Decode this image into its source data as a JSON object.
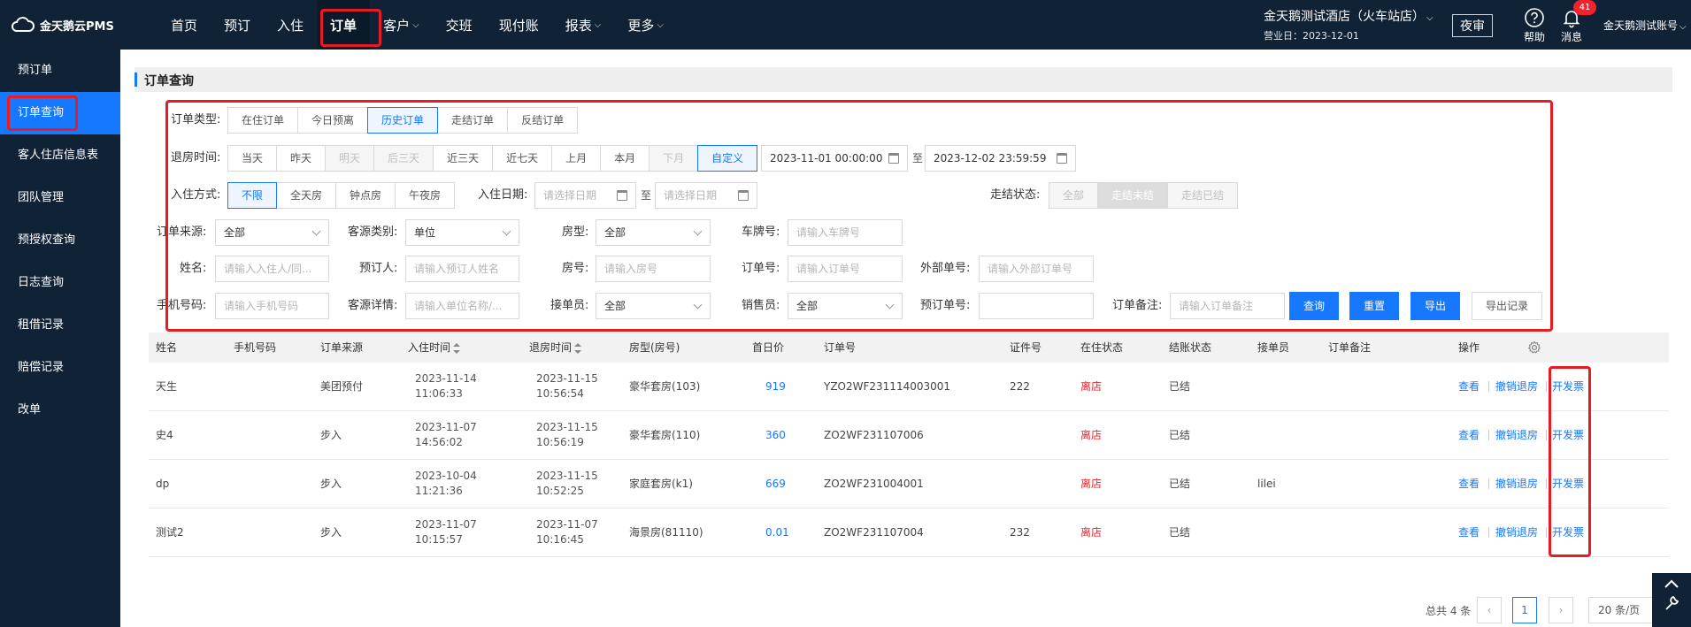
{
  "app": {
    "logo_text": "金天鹅云PMS"
  },
  "nav": [
    {
      "label": "首页",
      "chevron": false
    },
    {
      "label": "预订",
      "chevron": false
    },
    {
      "label": "入住",
      "chevron": false
    },
    {
      "label": "订单",
      "chevron": false,
      "active": true
    },
    {
      "label": "客户",
      "chevron": true
    },
    {
      "label": "交班",
      "chevron": false
    },
    {
      "label": "现付账",
      "chevron": false
    },
    {
      "label": "报表",
      "chevron": true
    },
    {
      "label": "更多",
      "chevron": true
    }
  ],
  "header": {
    "hotel_name": "金天鹅测试酒店（火车站店）",
    "business_date": "营业日：2023-12-01",
    "night_audit_label": "夜审",
    "help_label": "帮助",
    "messages_label": "消息",
    "message_count": "41",
    "user_name": "金天鹅测试账号"
  },
  "sidebar": [
    {
      "label": "预订单"
    },
    {
      "label": "订单查询",
      "active": true
    },
    {
      "label": "客人住店信息表"
    },
    {
      "label": "团队管理"
    },
    {
      "label": "预授权查询"
    },
    {
      "label": "日志查询"
    },
    {
      "label": "租借记录"
    },
    {
      "label": "赔偿记录"
    },
    {
      "label": "改单"
    }
  ],
  "page": {
    "title": "订单查询"
  },
  "filters": {
    "order_type": {
      "label": "订单类型:",
      "options": [
        "在住订单",
        "今日预离",
        "历史订单",
        "走结订单",
        "反结订单"
      ],
      "selected": "历史订单"
    },
    "checkout_time": {
      "label": "退房时间:",
      "options": [
        "当天",
        "昨天",
        "明天",
        "后三天",
        "近三天",
        "近七天",
        "上月",
        "本月",
        "下月",
        "自定义"
      ],
      "disabled": [
        "明天",
        "后三天",
        "下月"
      ],
      "selected": "自定义",
      "from": "2023-11-01 00:00:00",
      "to_label": "至",
      "to": "2023-12-02 23:59:59"
    },
    "checkin_method": {
      "label": "入住方式:",
      "options": [
        "不限",
        "全天房",
        "钟点房",
        "午夜房"
      ],
      "selected": "不限"
    },
    "checkin_date": {
      "label": "入住日期:",
      "placeholder_from": "请选择日期",
      "to_label": "至",
      "placeholder_to": "请选择日期"
    },
    "settle_status": {
      "label": "走结状态:",
      "options": [
        "全部",
        "走结未结",
        "走结已结"
      ]
    },
    "order_source": {
      "label": "订单来源:",
      "value": "全部"
    },
    "guest_category": {
      "label": "客源类别:",
      "value": "单位"
    },
    "room_type": {
      "label": "房型:",
      "value": "全部"
    },
    "plate": {
      "label": "车牌号:",
      "placeholder": "请输入车牌号"
    },
    "name": {
      "label": "姓名:",
      "placeholder": "请输入入住人/同..."
    },
    "booker": {
      "label": "预订人:",
      "placeholder": "请输入预订人姓名"
    },
    "room_no": {
      "label": "房号:",
      "placeholder": "请输入房号"
    },
    "order_no": {
      "label": "订单号:",
      "placeholder": "请输入订单号"
    },
    "external_no": {
      "label": "外部单号:",
      "placeholder": "请输入外部订单号"
    },
    "phone": {
      "label": "手机号码:",
      "placeholder": "请输入手机号码"
    },
    "guest_detail": {
      "label": "客源详情:",
      "placeholder": "请输入单位名称/..."
    },
    "receptionist": {
      "label": "接单员:",
      "value": "全部"
    },
    "salesperson": {
      "label": "销售员:",
      "value": "全部"
    },
    "booking_no": {
      "label": "预订单号:",
      "value": ""
    },
    "remark": {
      "label": "订单备注:",
      "placeholder": "请输入订单备注"
    },
    "buttons": {
      "search": "查询",
      "reset": "重置",
      "export": "导出",
      "export_log": "导出记录"
    }
  },
  "table": {
    "columns": [
      "姓名",
      "手机号码",
      "订单来源",
      "入住时间",
      "退房时间",
      "房型(房号)",
      "首日价",
      "订单号",
      "证件号",
      "在住状态",
      "结账状态",
      "接单员",
      "订单备注",
      "操作"
    ],
    "rows": [
      {
        "name": "天生",
        "phone": "",
        "source": "美团预付",
        "in_date": "2023-11-14",
        "in_time": "11:06:33",
        "out_date": "2023-11-15",
        "out_time": "10:56:54",
        "room": "豪华套房(103)",
        "price": "919",
        "order_no": "YZO2WF231114003001",
        "id_no": "222",
        "stay_status": "离店",
        "settle": "已结",
        "receptionist": "",
        "remark": ""
      },
      {
        "name": "史4",
        "phone": "",
        "source": "步入",
        "in_date": "2023-11-07",
        "in_time": "14:56:02",
        "out_date": "2023-11-15",
        "out_time": "10:56:19",
        "room": "豪华套房(110)",
        "price": "360",
        "order_no": "ZO2WF231107006",
        "id_no": "",
        "stay_status": "离店",
        "settle": "已结",
        "receptionist": "",
        "remark": ""
      },
      {
        "name": "dp",
        "phone": "",
        "source": "步入",
        "in_date": "2023-10-04",
        "in_time": "11:21:36",
        "out_date": "2023-11-15",
        "out_time": "10:52:25",
        "room": "家庭套房(k1)",
        "price": "669",
        "order_no": "ZO2WF231004001",
        "id_no": "",
        "stay_status": "离店",
        "settle": "已结",
        "receptionist": "lilei",
        "remark": ""
      },
      {
        "name": "测试2",
        "phone": "",
        "source": "步入",
        "in_date": "2023-11-07",
        "in_time": "10:15:57",
        "out_date": "2023-11-07",
        "out_time": "10:16:45",
        "room": "海景房(81110)",
        "price": "0.01",
        "order_no": "ZO2WF231107004",
        "id_no": "232",
        "stay_status": "离店",
        "settle": "已结",
        "receptionist": "",
        "remark": ""
      }
    ],
    "actions": [
      "查看",
      "撤销退房",
      "开发票"
    ]
  },
  "pagination": {
    "total": "总共 4 条",
    "current": "1",
    "page_size": "20 条/页"
  },
  "colors": {
    "primary": "#1677ff",
    "nav_bg": "#0f2236",
    "danger": "#f5222d",
    "highlight_box": "#e51c23"
  }
}
